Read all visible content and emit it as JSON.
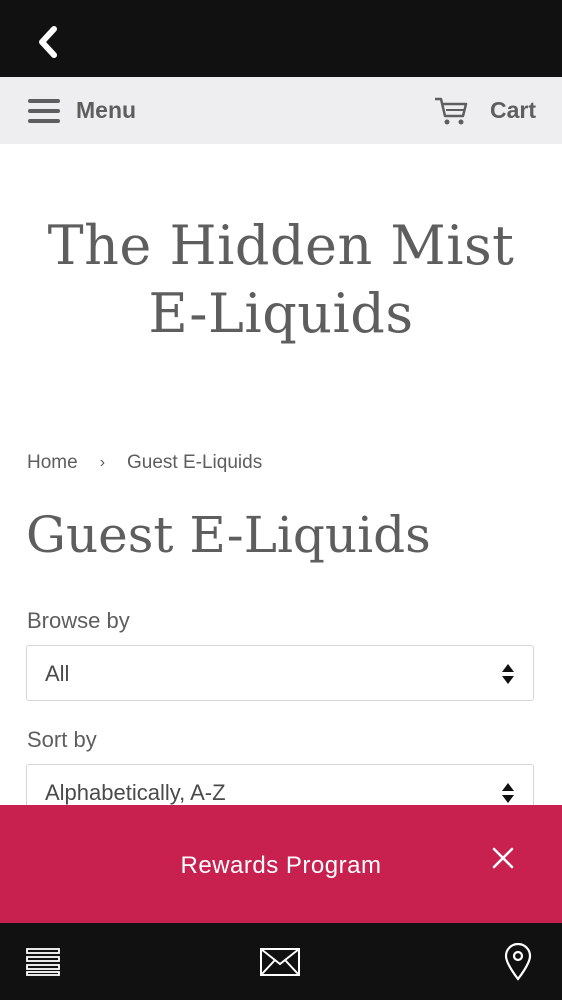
{
  "header": {
    "menu_label": "Menu",
    "cart_label": "Cart"
  },
  "site": {
    "title_line1": "The Hidden Mist",
    "title_line2": "E-Liquids"
  },
  "breadcrumb": {
    "home": "Home",
    "separator": "›",
    "current": "Guest E-Liquids"
  },
  "page": {
    "title": "Guest E-Liquids"
  },
  "filters": {
    "browse_label": "Browse by",
    "browse_value": "All",
    "sort_label": "Sort by",
    "sort_value": "Alphabetically, A-Z"
  },
  "banner": {
    "text": "Rewards Program",
    "color": "#c8214f"
  },
  "icons": {
    "back": "chevron-left-icon",
    "menu": "hamburger-icon",
    "cart": "cart-icon",
    "close": "close-icon",
    "bottom_list": "list-icon",
    "bottom_mail": "mail-icon",
    "bottom_location": "location-pin-icon"
  }
}
